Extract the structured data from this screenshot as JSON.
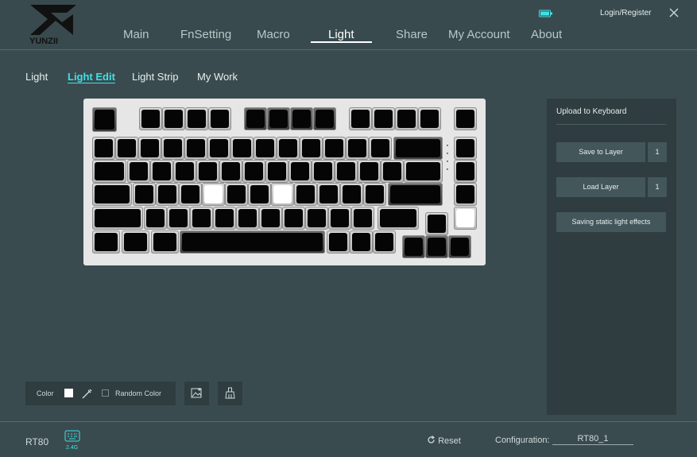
{
  "brand": {
    "logo_text": "YUNZII"
  },
  "nav": {
    "items": [
      {
        "label": "Main"
      },
      {
        "label": "FnSetting"
      },
      {
        "label": "Macro"
      },
      {
        "label": "Light"
      },
      {
        "label": "Share"
      },
      {
        "label": "My Account"
      },
      {
        "label": "About"
      }
    ],
    "active": "Light"
  },
  "header": {
    "login_label": "Login/Register",
    "battery_color": "#3fe0e6"
  },
  "subtabs": {
    "items": [
      {
        "label": "Light"
      },
      {
        "label": "Light Edit"
      },
      {
        "label": "Light Strip"
      },
      {
        "label": "My Work"
      }
    ],
    "active": "Light Edit"
  },
  "keyboard": {
    "lit_keys": [
      "F",
      "J",
      "Num 5"
    ],
    "indicator_icons": [
      "caps-lock-icon",
      "mode-icon",
      "battery-icon",
      "power-icon"
    ]
  },
  "panel": {
    "title": "Upload to Keyboard",
    "save_label": "Save to Layer",
    "save_value": "1",
    "load_label": "Load Layer",
    "load_value": "1",
    "static_label": "Saving static light effects"
  },
  "color_tools": {
    "color_label": "Color",
    "selected_color": "#ffffff",
    "random_label": "Random Color",
    "random_checked": false
  },
  "footer": {
    "model": "RT80",
    "connection": "2.4G",
    "reset_label": "Reset",
    "config_label": "Configuration:",
    "config_value": "RT80_1"
  },
  "colors": {
    "accent": "#3fe0e6",
    "background": "#3a4b4f",
    "panel": "#2f3d40"
  }
}
